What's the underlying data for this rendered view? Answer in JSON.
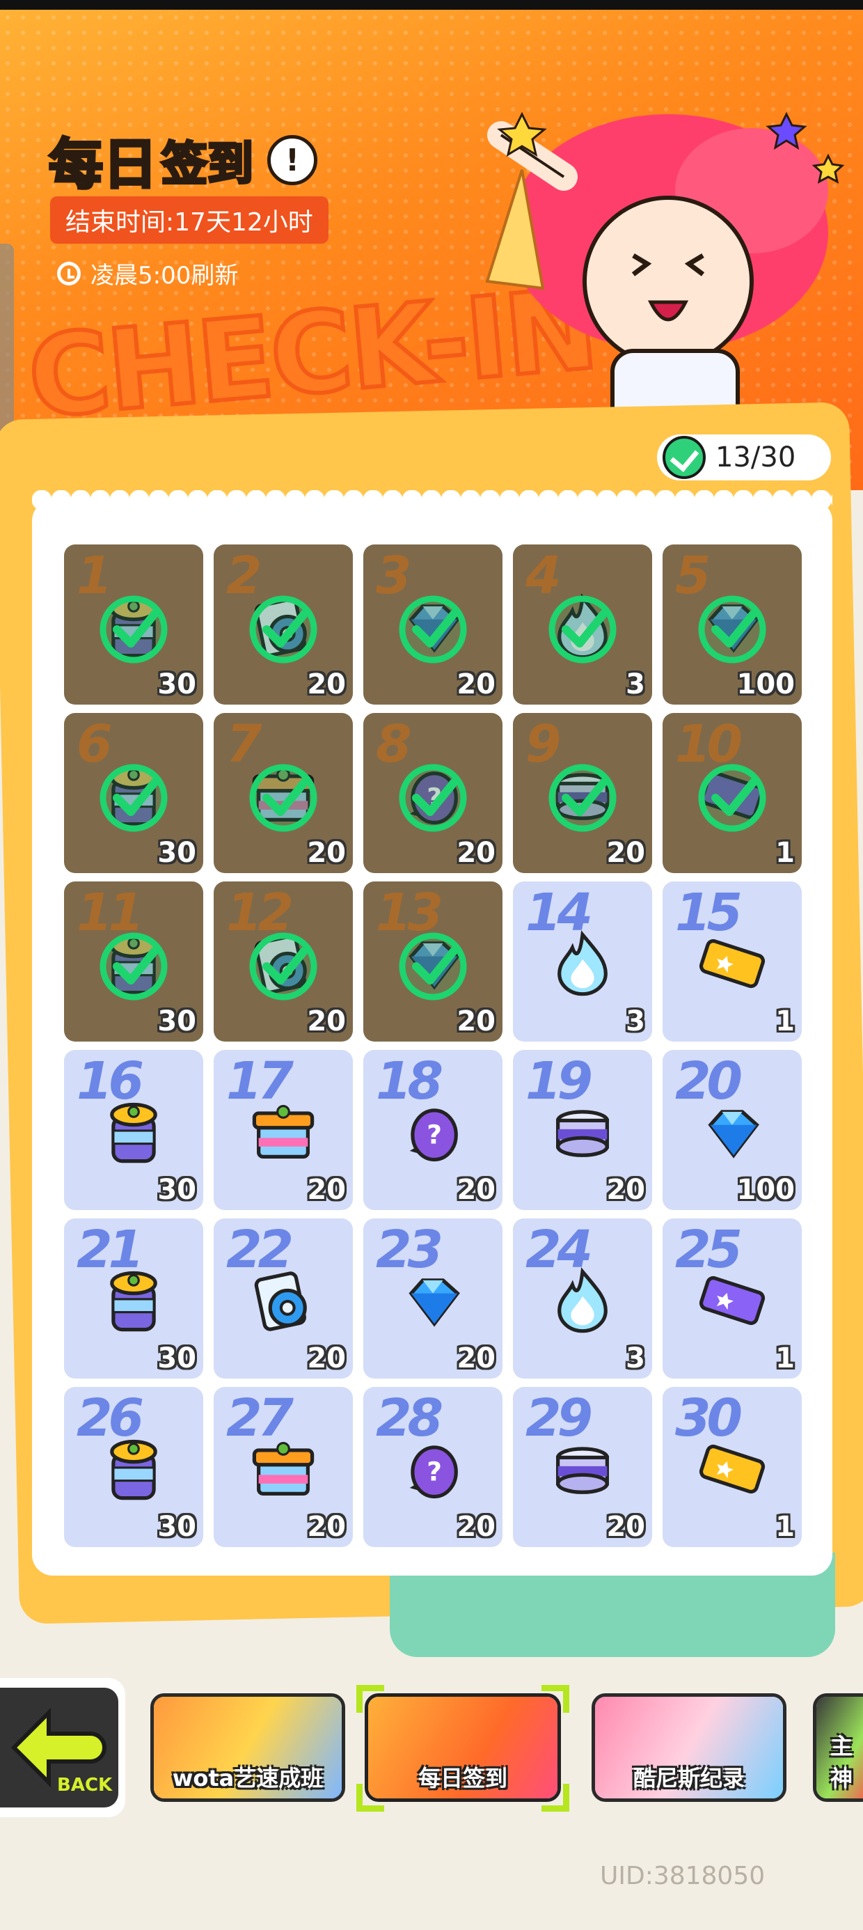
{
  "header": {
    "title_a": "每日",
    "title_b": "签到",
    "end_time": "结束时间:17天12小时",
    "refresh": "凌晨5:00刷新",
    "banner_word": "CHECK-IN"
  },
  "progress": {
    "text": "13/30",
    "checked": 13,
    "total": 30
  },
  "days": [
    {
      "day": "1",
      "qty": "30",
      "icon": "jar-icon",
      "done": true
    },
    {
      "day": "2",
      "qty": "20",
      "icon": "tape-roll-icon",
      "done": true
    },
    {
      "day": "3",
      "qty": "20",
      "icon": "diamond-icon",
      "done": true
    },
    {
      "day": "4",
      "qty": "3",
      "icon": "flame-icon",
      "done": true
    },
    {
      "day": "5",
      "qty": "100",
      "icon": "diamond-icon",
      "done": true
    },
    {
      "day": "6",
      "qty": "30",
      "icon": "jar-icon",
      "done": true
    },
    {
      "day": "7",
      "qty": "20",
      "icon": "box-icon",
      "done": true
    },
    {
      "day": "8",
      "qty": "20",
      "icon": "mystery-egg-icon",
      "done": true
    },
    {
      "day": "9",
      "qty": "20",
      "icon": "can-icon",
      "done": true
    },
    {
      "day": "10",
      "qty": "1",
      "icon": "ticket-icon",
      "done": true
    },
    {
      "day": "11",
      "qty": "30",
      "icon": "jar-icon",
      "done": true
    },
    {
      "day": "12",
      "qty": "20",
      "icon": "tape-roll-icon",
      "done": true
    },
    {
      "day": "13",
      "qty": "20",
      "icon": "diamond-icon",
      "done": true
    },
    {
      "day": "14",
      "qty": "3",
      "icon": "flame-icon",
      "done": false
    },
    {
      "day": "15",
      "qty": "1",
      "icon": "gold-ticket-icon",
      "done": false
    },
    {
      "day": "16",
      "qty": "30",
      "icon": "jar-icon",
      "done": false
    },
    {
      "day": "17",
      "qty": "20",
      "icon": "box-icon",
      "done": false
    },
    {
      "day": "18",
      "qty": "20",
      "icon": "mystery-egg-icon",
      "done": false
    },
    {
      "day": "19",
      "qty": "20",
      "icon": "can-icon",
      "done": false
    },
    {
      "day": "20",
      "qty": "100",
      "icon": "diamond-icon",
      "done": false
    },
    {
      "day": "21",
      "qty": "30",
      "icon": "jar-icon",
      "done": false
    },
    {
      "day": "22",
      "qty": "20",
      "icon": "tape-roll-icon",
      "done": false
    },
    {
      "day": "23",
      "qty": "20",
      "icon": "diamond-icon",
      "done": false
    },
    {
      "day": "24",
      "qty": "3",
      "icon": "flame-icon",
      "done": false
    },
    {
      "day": "25",
      "qty": "1",
      "icon": "purple-ticket-icon",
      "done": false
    },
    {
      "day": "26",
      "qty": "30",
      "icon": "jar-icon",
      "done": false
    },
    {
      "day": "27",
      "qty": "20",
      "icon": "box-icon",
      "done": false
    },
    {
      "day": "28",
      "qty": "20",
      "icon": "mystery-egg-icon",
      "done": false
    },
    {
      "day": "29",
      "qty": "20",
      "icon": "can-icon",
      "done": false
    },
    {
      "day": "30",
      "qty": "1",
      "icon": "gold-ticket-icon",
      "done": false
    }
  ],
  "nav": {
    "back_label": "BACK",
    "tabs": [
      {
        "label": "wota艺速成班"
      },
      {
        "label": "每日签到",
        "active": true
      },
      {
        "label": "酷尼斯纪录"
      },
      {
        "label": "主神"
      }
    ]
  },
  "footer": {
    "uid": "UID:3818050"
  },
  "colors": {
    "banner_orange": "#ff7a1f",
    "panel_yellow": "#ffc64b",
    "done_cell": "#7e6a4b",
    "todo_cell": "#d3dcf8",
    "check_green": "#2ed17a",
    "active_tab_frame": "#b6e61e"
  }
}
